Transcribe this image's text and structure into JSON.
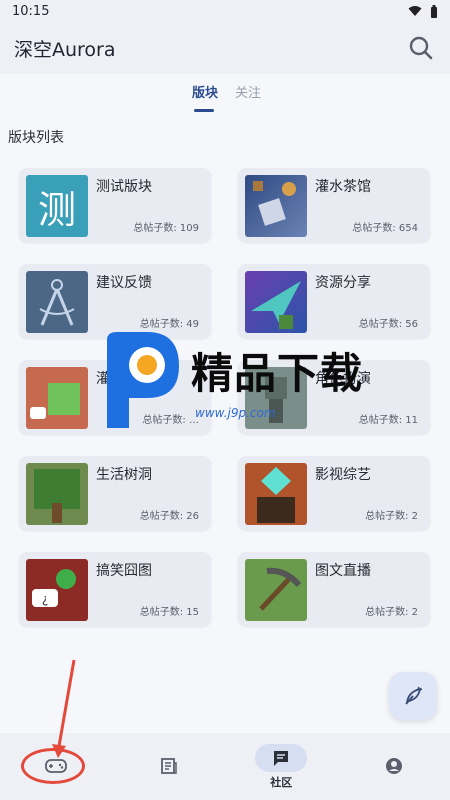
{
  "status": {
    "time": "10:15"
  },
  "appbar": {
    "title": "深空Aurora"
  },
  "tabs": [
    {
      "label": "版块",
      "active": true
    },
    {
      "label": "关注",
      "active": false
    }
  ],
  "section": {
    "title": "版块列表"
  },
  "boards": [
    {
      "name": "测试版块",
      "posts": "总帖子数: 109",
      "thumb": "测"
    },
    {
      "name": "灌水茶馆",
      "posts": "总帖子数: 654"
    },
    {
      "name": "建议反馈",
      "posts": "总帖子数: 49"
    },
    {
      "name": "资源分享",
      "posts": "总帖子数: 56"
    },
    {
      "name": "灌…闲…",
      "posts": "总帖子数: …"
    },
    {
      "name": "角色扮演",
      "posts": "总帖子数: 11"
    },
    {
      "name": "生活树洞",
      "posts": "总帖子数: 26"
    },
    {
      "name": "影视综艺",
      "posts": "总帖子数: 2"
    },
    {
      "name": "搞笑囧图",
      "posts": "总帖子数: 15"
    },
    {
      "name": "图文直播",
      "posts": "总帖子数: 2"
    }
  ],
  "nav": [
    {
      "label": ""
    },
    {
      "label": ""
    },
    {
      "label": "社区",
      "active": true
    },
    {
      "label": ""
    }
  ],
  "watermark": {
    "text": "精品下载",
    "url": "www.j9p.com"
  },
  "colors": {
    "accent": "#2a4c8f",
    "annotation": "#e34a3b",
    "card": "#e9ebf2"
  }
}
